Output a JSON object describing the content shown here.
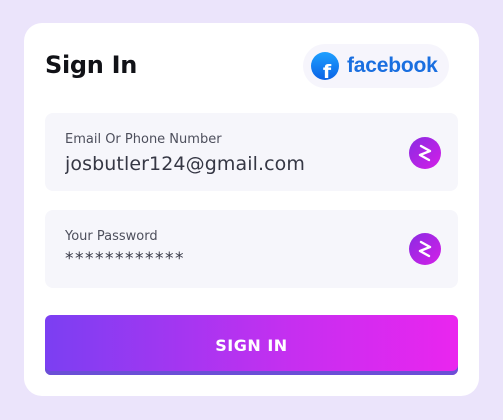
{
  "form": {
    "title": "Sign In",
    "social": {
      "label": "facebook",
      "icon": "facebook-icon",
      "icon_glyph": "f"
    },
    "email": {
      "label": "Email Or Phone Number",
      "value": "josbutler124@gmail.com",
      "icon": "shield-s-icon"
    },
    "password": {
      "label": "Your Password",
      "value": "************",
      "icon": "shield-s-icon"
    },
    "submit_label": "SIGN IN"
  },
  "colors": {
    "background": "#ebe4fb",
    "card": "#ffffff",
    "field": "#f6f6fb",
    "facebook_blue": "#1a6fe0",
    "button_gradient_start": "#7b3ff2",
    "button_gradient_end": "#ea25ef"
  }
}
